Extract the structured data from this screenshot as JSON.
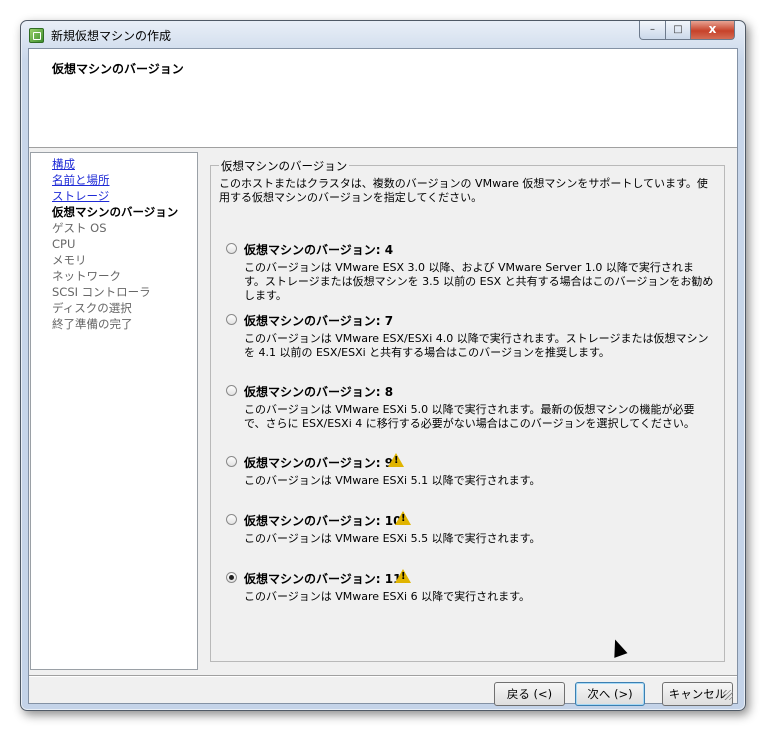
{
  "window": {
    "title": "新規仮想マシンの作成",
    "controls": {
      "minimize": "–",
      "maximize": "□",
      "close": "x"
    }
  },
  "header": {
    "title": "仮想マシンのバージョン"
  },
  "nav": {
    "items": [
      {
        "label": "構成",
        "state": "done"
      },
      {
        "label": "名前と場所",
        "state": "done"
      },
      {
        "label": "ストレージ",
        "state": "done"
      },
      {
        "label": "仮想マシンのバージョン",
        "state": "current"
      },
      {
        "label": "ゲスト OS",
        "state": "todo"
      },
      {
        "label": "CPU",
        "state": "todo"
      },
      {
        "label": "メモリ",
        "state": "todo"
      },
      {
        "label": "ネットワーク",
        "state": "todo"
      },
      {
        "label": "SCSI コントローラ",
        "state": "todo"
      },
      {
        "label": "ディスクの選択",
        "state": "todo"
      },
      {
        "label": "終了準備の完了",
        "state": "todo"
      }
    ]
  },
  "group": {
    "label": "仮想マシンのバージョン",
    "intro": "このホストまたはクラスタは、複数のバージョンの VMware 仮想マシンをサポートしています。使用する仮想マシンのバージョンを指定してください。",
    "options": [
      {
        "label": "仮想マシンのバージョン: 4",
        "desc": "このバージョンは VMware ESX 3.0 以降、および VMware Server 1.0 以降で実行されます。ストレージまたは仮想マシンを 3.5 以前の ESX と共有する場合はこのバージョンをお勧めします。",
        "selected": false,
        "warning": false
      },
      {
        "label": "仮想マシンのバージョン: 7",
        "desc": "このバージョンは VMware ESX/ESXi 4.0 以降で実行されます。ストレージまたは仮想マシンを 4.1 以前の ESX/ESXi と共有する場合はこのバージョンを推奨します。",
        "selected": false,
        "warning": false
      },
      {
        "label": "仮想マシンのバージョン: 8",
        "desc": "このバージョンは VMware ESXi 5.0 以降で実行されます。最新の仮想マシンの機能が必要で、さらに ESX/ESXi 4 に移行する必要がない場合はこのバージョンを選択してください。",
        "selected": false,
        "warning": false
      },
      {
        "label": "仮想マシンのバージョン: 9",
        "desc": "このバージョンは VMware ESXi 5.1 以降で実行されます。",
        "selected": false,
        "warning": true
      },
      {
        "label": "仮想マシンのバージョン: 10",
        "desc": "このバージョンは VMware ESXi 5.5 以降で実行されます。",
        "selected": false,
        "warning": true
      },
      {
        "label": "仮想マシンのバージョン: 11",
        "desc": "このバージョンは VMware ESXi 6 以降で実行されます。",
        "selected": true,
        "warning": true
      }
    ]
  },
  "buttons": {
    "back": "戻る (<)",
    "next": "次へ (>)",
    "cancel": "キャンセル"
  },
  "colors": {
    "link": "#1f2bd6",
    "warning": "#e0b400",
    "close": "#c7422a"
  }
}
